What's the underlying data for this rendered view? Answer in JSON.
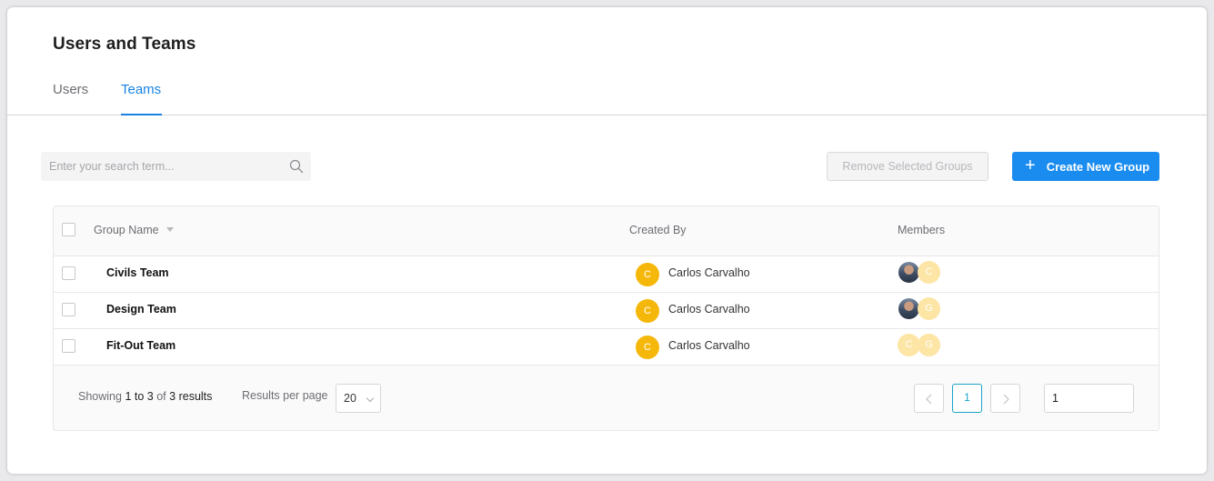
{
  "page": {
    "title": "Users and Teams"
  },
  "tabs": [
    {
      "label": "Users",
      "active": false
    },
    {
      "label": "Teams",
      "active": true
    }
  ],
  "search": {
    "placeholder": "Enter your search term...",
    "value": ""
  },
  "actions": {
    "remove_label": "Remove Selected Groups",
    "create_label": "Create New Group",
    "create_icon": "plus-icon"
  },
  "table": {
    "columns": {
      "group_name": "Group Name",
      "created_by": "Created By",
      "members": "Members"
    },
    "rows": [
      {
        "name": "Civils Team",
        "creator_initial": "C",
        "creator_name": "Carlos Carvalho",
        "members": [
          {
            "type": "photo"
          },
          {
            "type": "letter",
            "initial": "C"
          }
        ]
      },
      {
        "name": "Design Team",
        "creator_initial": "C",
        "creator_name": "Carlos Carvalho",
        "members": [
          {
            "type": "photo"
          },
          {
            "type": "letter",
            "initial": "G"
          }
        ]
      },
      {
        "name": "Fit-Out Team",
        "creator_initial": "C",
        "creator_name": "Carlos Carvalho",
        "members": [
          {
            "type": "letter",
            "initial": "C"
          },
          {
            "type": "letter",
            "initial": "G"
          }
        ]
      }
    ]
  },
  "footer": {
    "showing_prefix": "Showing",
    "range_start": "1",
    "range_to": "to",
    "range_end": "3",
    "of": "of",
    "total": "3",
    "results": "results",
    "rpp_label": "Results per page",
    "rpp_value": "20",
    "prev_icon": "chevron-left-icon",
    "next_icon": "chevron-right-icon",
    "current_page": "1",
    "page_input_value": "1"
  },
  "colors": {
    "accent": "#1a82e2",
    "primary_button": "#1a8cf0",
    "creator_avatar": "#f5b80a",
    "member_avatar_light": "#fde5a5",
    "pagination_active": "#1aa4c7"
  }
}
